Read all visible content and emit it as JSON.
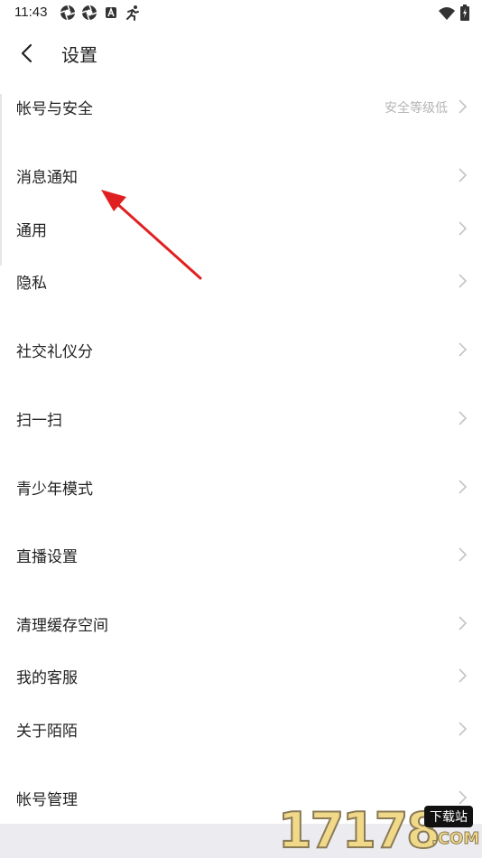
{
  "status_bar": {
    "time": "11:43",
    "left_icons": [
      "aperture-icon",
      "aperture-icon",
      "font-badge-icon",
      "runner-icon"
    ],
    "right_icons": [
      "wifi-icon",
      "battery-charging-icon"
    ]
  },
  "header": {
    "back_icon": "chevron-left-icon",
    "title": "设置"
  },
  "menu": {
    "items": [
      {
        "label": "帐号与安全",
        "extra": "安全等级低"
      },
      {
        "label": "消息通知"
      },
      {
        "label": "通用"
      },
      {
        "label": "隐私"
      },
      {
        "label": "社交礼仪分"
      },
      {
        "label": "扫一扫"
      },
      {
        "label": "青少年模式"
      },
      {
        "label": "直播设置"
      },
      {
        "label": "清理缓存空间"
      },
      {
        "label": "我的客服"
      },
      {
        "label": "关于陌陌"
      },
      {
        "label": "帐号管理"
      }
    ]
  },
  "annotation": {
    "arrow_color": "#e02020"
  },
  "watermark": {
    "digits": "17178",
    "badge": "下载站",
    "suffix": ".COM"
  },
  "colors": {
    "text": "#222222",
    "secondary_text": "#b5b5b5",
    "chevron": "#c4c4c4",
    "bottom_strip": "#ececf0"
  }
}
